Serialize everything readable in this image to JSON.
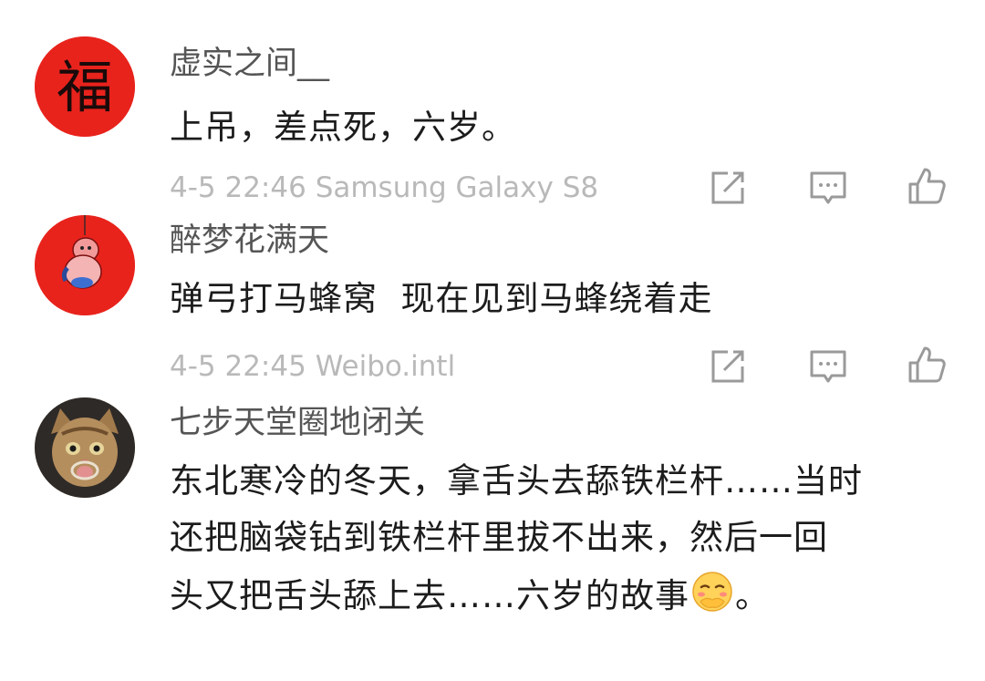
{
  "comments": [
    {
      "username": "虚实之间__",
      "avatar_icon": "fu-character-avatar",
      "avatar_char": "福",
      "text": "上吊，差点死，六岁。",
      "time": "4-5 22:46",
      "device": "Samsung Galaxy S8"
    },
    {
      "username": "醉梦花满天",
      "avatar_icon": "cartoon-character-avatar",
      "text": "弹弓打马蜂窝  现在见到马蜂绕着走",
      "time": "4-5 22:45",
      "device": "Weibo.intl"
    },
    {
      "username": "七步天堂圈地闭关",
      "avatar_icon": "cat-photo-avatar",
      "text_lines": [
        "东北寒冷的冬天，拿舌头去舔铁栏杆……当时",
        "还把脑袋钻到铁栏杆里拔不出来，然后一回",
        "头又把舌头舔上去……六岁的故事"
      ],
      "text_tail": "。",
      "emoji": "embarrassed-face-emoji"
    }
  ],
  "actions": {
    "repost_icon": "repost-icon",
    "comment_icon": "comment-icon",
    "like_icon": "like-icon"
  },
  "colors": {
    "username": "#555555",
    "meta": "#b9b9b9",
    "text": "#1c1c1c",
    "avatar_red": "#e8231c",
    "icon_gray": "#9a9a9a"
  }
}
